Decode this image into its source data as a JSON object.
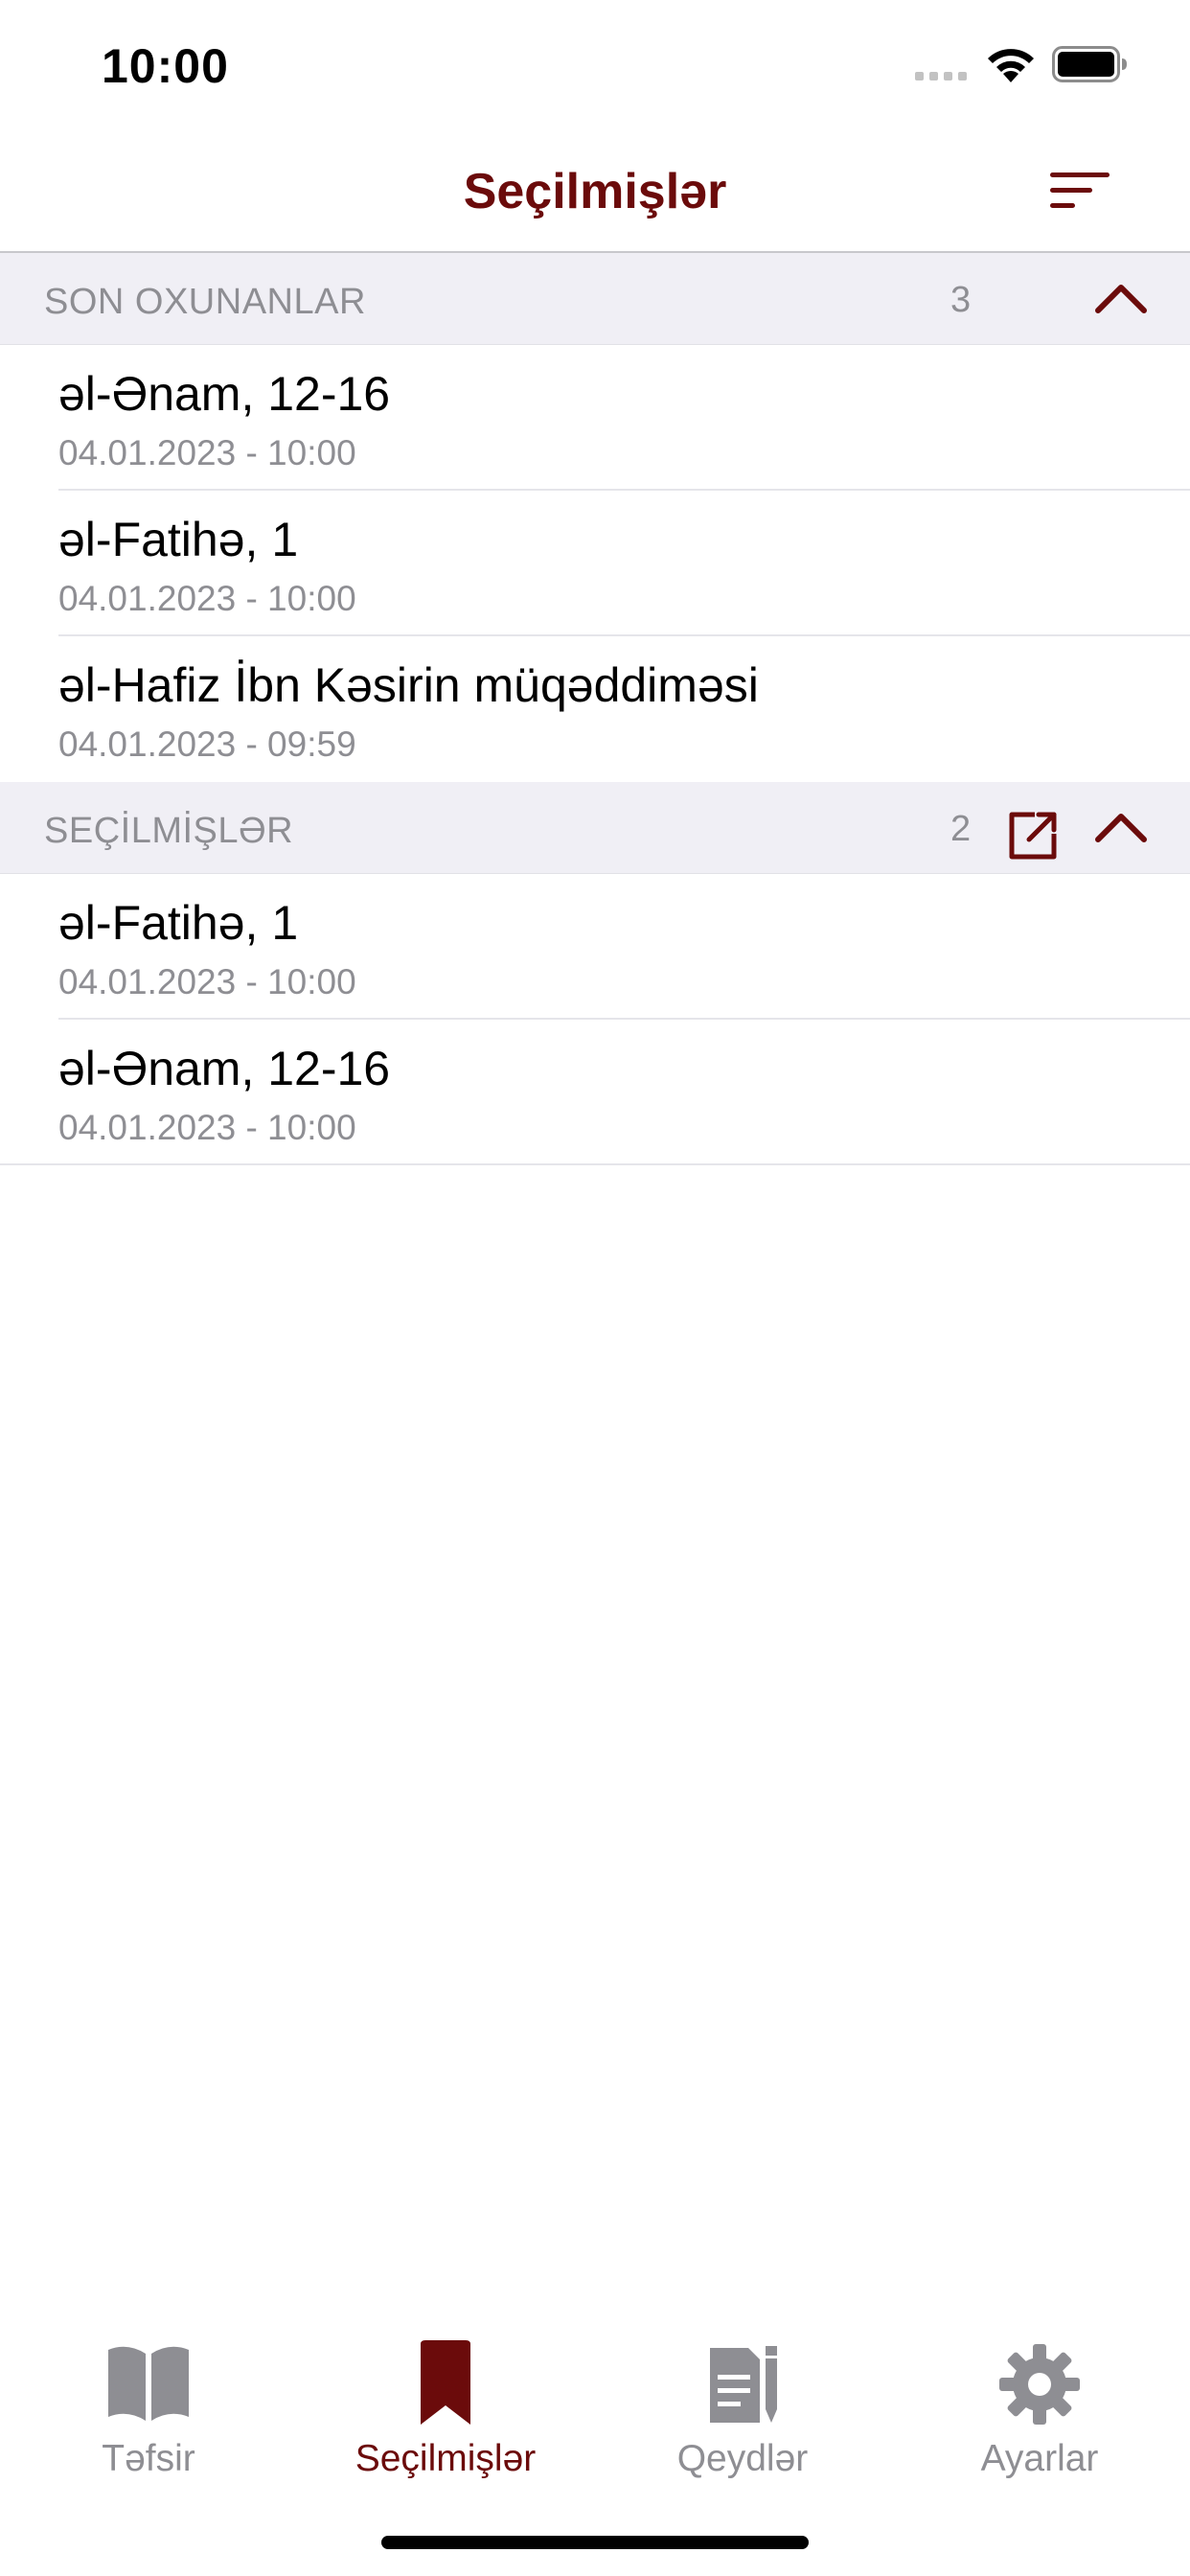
{
  "status_bar": {
    "time": "10:00"
  },
  "nav": {
    "title": "Seçilmişlər",
    "sort_icon": "sort-lines-icon"
  },
  "colors": {
    "accent": "#6b0b0b",
    "section_bg": "#f0eff5",
    "secondary_text": "#8e8e93",
    "tab_inactive": "#8e8e93"
  },
  "recent": {
    "header": "SON OXUNANLAR",
    "count": "3",
    "items": [
      {
        "title": "əl-Ənam, 12-16",
        "date": "04.01.2023 - 10:00"
      },
      {
        "title": "əl-Fatihə, 1",
        "date": "04.01.2023 - 10:00"
      },
      {
        "title": "əl-Hafiz İbn Kəsirin müqəddiməsi",
        "date": "04.01.2023 - 09:59"
      }
    ]
  },
  "favorites": {
    "header": "SEÇİLMİŞLƏR",
    "count": "2",
    "items": [
      {
        "title": "əl-Fatihə, 1",
        "date": "04.01.2023 - 10:00"
      },
      {
        "title": "əl-Ənam, 12-16",
        "date": "04.01.2023 - 10:00"
      }
    ]
  },
  "tabs": [
    {
      "label": "Təfsir",
      "icon": "book-icon",
      "active": false
    },
    {
      "label": "Seçilmişlər",
      "icon": "bookmark-icon",
      "active": true
    },
    {
      "label": "Qeydlər",
      "icon": "notes-icon",
      "active": false
    },
    {
      "label": "Ayarlar",
      "icon": "gear-icon",
      "active": false
    }
  ]
}
